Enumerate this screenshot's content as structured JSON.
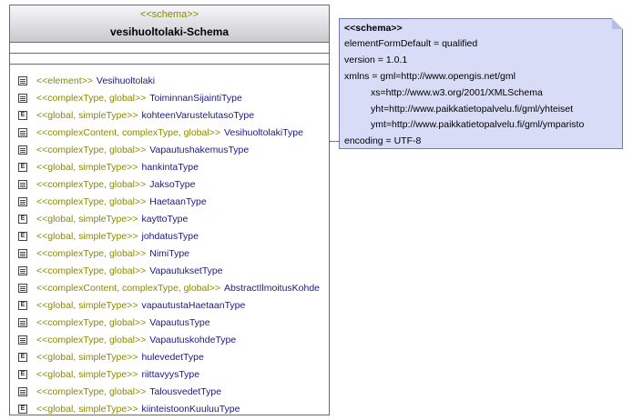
{
  "schema_box": {
    "stereotype": "<<schema>>",
    "title": "vesihuoltolaki-Schema",
    "items": [
      {
        "icon": "struct",
        "stereotype": "<<element>>",
        "name": "Vesihuoltolaki"
      },
      {
        "icon": "struct",
        "stereotype": "<<complexType, global>>",
        "name": "ToiminnanSijaintiType"
      },
      {
        "icon": "enum",
        "stereotype": "<<global, simpleType>>",
        "name": "kohteenVarustelutasoType"
      },
      {
        "icon": "struct",
        "stereotype": "<<complexContent, complexType, global>>",
        "name": "VesihuoltolakiType"
      },
      {
        "icon": "struct",
        "stereotype": "<<complexType, global>>",
        "name": "VapautushakemusType"
      },
      {
        "icon": "enum",
        "stereotype": "<<global, simpleType>>",
        "name": "hankintaType"
      },
      {
        "icon": "struct",
        "stereotype": "<<complexType, global>>",
        "name": "JaksoType"
      },
      {
        "icon": "struct",
        "stereotype": "<<complexType, global>>",
        "name": "HaetaanType"
      },
      {
        "icon": "enum",
        "stereotype": "<<global, simpleType>>",
        "name": "kayttoType"
      },
      {
        "icon": "enum",
        "stereotype": "<<global, simpleType>>",
        "name": "johdatusType"
      },
      {
        "icon": "struct",
        "stereotype": "<<complexType, global>>",
        "name": "NimiType"
      },
      {
        "icon": "struct",
        "stereotype": "<<complexType, global>>",
        "name": "VapautuksetType"
      },
      {
        "icon": "struct",
        "stereotype": "<<complexContent, complexType, global>>",
        "name": "AbstractIlmoitusKohde"
      },
      {
        "icon": "enum",
        "stereotype": "<<global, simpleType>>",
        "name": "vapautustaHaetaanType"
      },
      {
        "icon": "struct",
        "stereotype": "<<complexType, global>>",
        "name": "VapautusType"
      },
      {
        "icon": "struct",
        "stereotype": "<<complexType, global>>",
        "name": "VapautuskohdeType"
      },
      {
        "icon": "enum",
        "stereotype": "<<global, simpleType>>",
        "name": "hulevedetType"
      },
      {
        "icon": "enum",
        "stereotype": "<<global, simpleType>>",
        "name": "riittavyysType"
      },
      {
        "icon": "struct",
        "stereotype": "<<complexType, global>>",
        "name": "TalousvedetType"
      },
      {
        "icon": "enum",
        "stereotype": "<<global, simpleType>>",
        "name": "kiinteistoonKuuluuType"
      }
    ]
  },
  "note": {
    "title": "<<schema>>",
    "lines": [
      "elementFormDefault = qualified",
      "version = 1.0.1",
      "xmlns = gml=http://www.opengis.net/gml",
      "xs=http://www.w3.org/2001/XMLSchema",
      "yht=http://www.paikkatietopalvelu.fi/gml/yhteiset",
      "ymt=http://www.paikkatietopalvelu.fi/gml/ymparisto",
      "encoding = UTF-8"
    ]
  },
  "icons": {
    "struct": "struct-icon",
    "enum": "enum-icon"
  },
  "colors": {
    "stereotype": "#8a8a00",
    "name": "#1a1a80",
    "note_bg": "#d9dcf7"
  }
}
